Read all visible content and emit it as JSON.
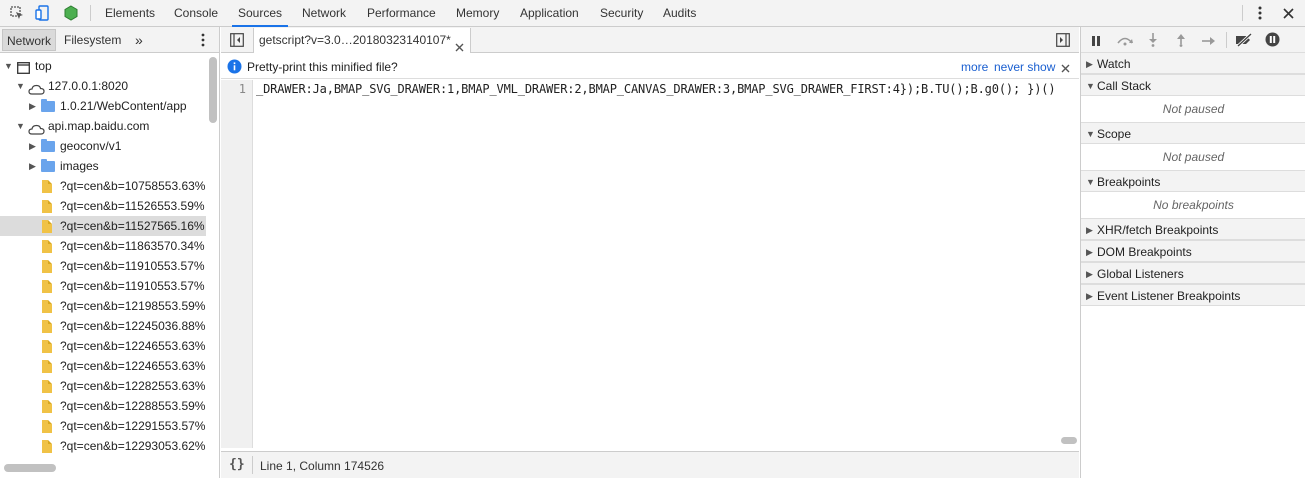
{
  "toolbar": {
    "tabs": [
      {
        "label": "Elements"
      },
      {
        "label": "Console"
      },
      {
        "label": "Sources"
      },
      {
        "label": "Network"
      },
      {
        "label": "Performance"
      },
      {
        "label": "Memory"
      },
      {
        "label": "Application"
      },
      {
        "label": "Security"
      },
      {
        "label": "Audits"
      }
    ],
    "active_tab": "Sources",
    "more_icon": "more-vert-icon",
    "close_icon": "close-icon"
  },
  "navigator": {
    "tabs": [
      {
        "label": "Network"
      },
      {
        "label": "Filesystem"
      }
    ],
    "more_tabs_label": "»",
    "tree": [
      {
        "label": "top"
      },
      {
        "label": "127.0.0.1:8020"
      },
      {
        "label": "1.0.21/WebContent/app"
      },
      {
        "label": "api.map.baidu.com"
      },
      {
        "label": "geoconv/v1"
      },
      {
        "label": "images"
      },
      {
        "label": "?qt=cen&b=10758553.63%"
      },
      {
        "label": "?qt=cen&b=11526553.59%"
      },
      {
        "label": "?qt=cen&b=11527565.16%"
      },
      {
        "label": "?qt=cen&b=11863570.34%"
      },
      {
        "label": "?qt=cen&b=11910553.57%"
      },
      {
        "label": "?qt=cen&b=11910553.57%"
      },
      {
        "label": "?qt=cen&b=12198553.59%"
      },
      {
        "label": "?qt=cen&b=12245036.88%"
      },
      {
        "label": "?qt=cen&b=12246553.63%"
      },
      {
        "label": "?qt=cen&b=12246553.63%"
      },
      {
        "label": "?qt=cen&b=12282553.63%"
      },
      {
        "label": "?qt=cen&b=12288553.59%"
      },
      {
        "label": "?qt=cen&b=12291553.57%"
      },
      {
        "label": "?qt=cen&b=12293053.62%"
      }
    ]
  },
  "editor": {
    "file_tab": "getscript?v=3.0…20180323140107*",
    "infobar": {
      "message": "Pretty-print this minified file?",
      "more": "more",
      "never_show": "never show"
    },
    "line_number": "1",
    "code_line": "_DRAWER:Ja,BMAP_SVG_DRAWER:1,BMAP_VML_DRAWER:2,BMAP_CANVAS_DRAWER:3,BMAP_SVG_DRAWER_FIRST:4});B.TU();B.g0(); })()",
    "status": {
      "format_icon": "{}",
      "position": "Line 1, Column 174526"
    }
  },
  "debugger": {
    "panes": [
      {
        "label": "Watch",
        "expanded": false
      },
      {
        "label": "Call Stack",
        "expanded": true,
        "empty": "Not paused"
      },
      {
        "label": "Scope",
        "expanded": true,
        "empty": "Not paused"
      },
      {
        "label": "Breakpoints",
        "expanded": true,
        "empty": "No breakpoints"
      },
      {
        "label": "XHR/fetch Breakpoints",
        "expanded": false
      },
      {
        "label": "DOM Breakpoints",
        "expanded": false
      },
      {
        "label": "Global Listeners",
        "expanded": false
      },
      {
        "label": "Event Listener Breakpoints",
        "expanded": false
      }
    ]
  },
  "colors": {
    "accent": "#1a73e8",
    "folder": "#6aa4ec",
    "file": "#f0c246",
    "toolbar_bg": "#f3f3f3"
  }
}
